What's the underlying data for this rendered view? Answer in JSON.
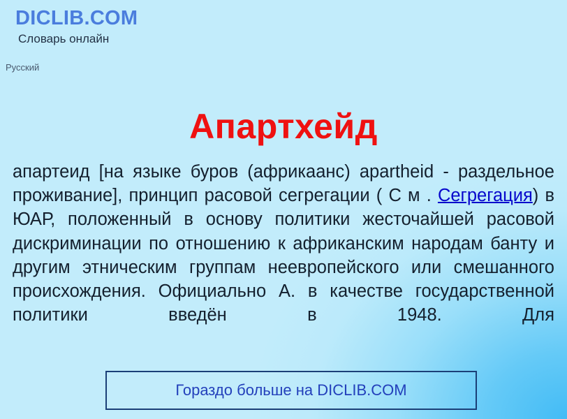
{
  "header": {
    "logo": "DICLIB.COM",
    "tagline": "Словарь онлайн",
    "language": "Русский"
  },
  "entry": {
    "title": "Апартхейд",
    "definition_part1": "апартеид [на языке буров (африкаанс) apartheid - раздельное проживание], принцип расовой сегрегации ( С м . ",
    "definition_link": "Сегрегация",
    "definition_part2": ") в ЮАР, положенный в основу политики жесточайшей расовой дискриминации по отношению к африканским народам банту и другим этническим группам неевропейского или смешанного происхождения. Официально А. в качестве государственной политики введён в 1948. Для"
  },
  "cta": {
    "label": "Гораздо больше на DICLIB.COM"
  },
  "colors": {
    "background_base": "#c2ecfb",
    "background_accent": "#3cb9f5",
    "logo": "#4a7ddd",
    "tagline": "#233246",
    "language": "#4a5a6e",
    "title": "#ef1111",
    "body_text": "#14202e",
    "link": "#0707cc",
    "cta_border": "#1b3f77",
    "cta_text": "#2340bb"
  }
}
